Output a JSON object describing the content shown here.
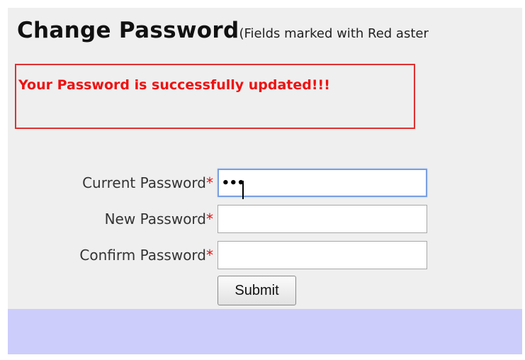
{
  "page": {
    "title": "Change Password",
    "title_note": "(Fields marked with Red aster"
  },
  "message": {
    "text": "Your Password is successfully updated!!!"
  },
  "form": {
    "required_marker": "*",
    "current_password": {
      "label": "Current Password",
      "value": "•••"
    },
    "new_password": {
      "label": "New Password",
      "value": ""
    },
    "confirm_password": {
      "label": "Confirm Password",
      "value": ""
    },
    "submit_label": "Submit"
  },
  "colors": {
    "panel_bg": "#efefef",
    "footer_band": "#cccdfb",
    "message_red": "#ee1111",
    "focus_border": "#7a9fe0"
  }
}
